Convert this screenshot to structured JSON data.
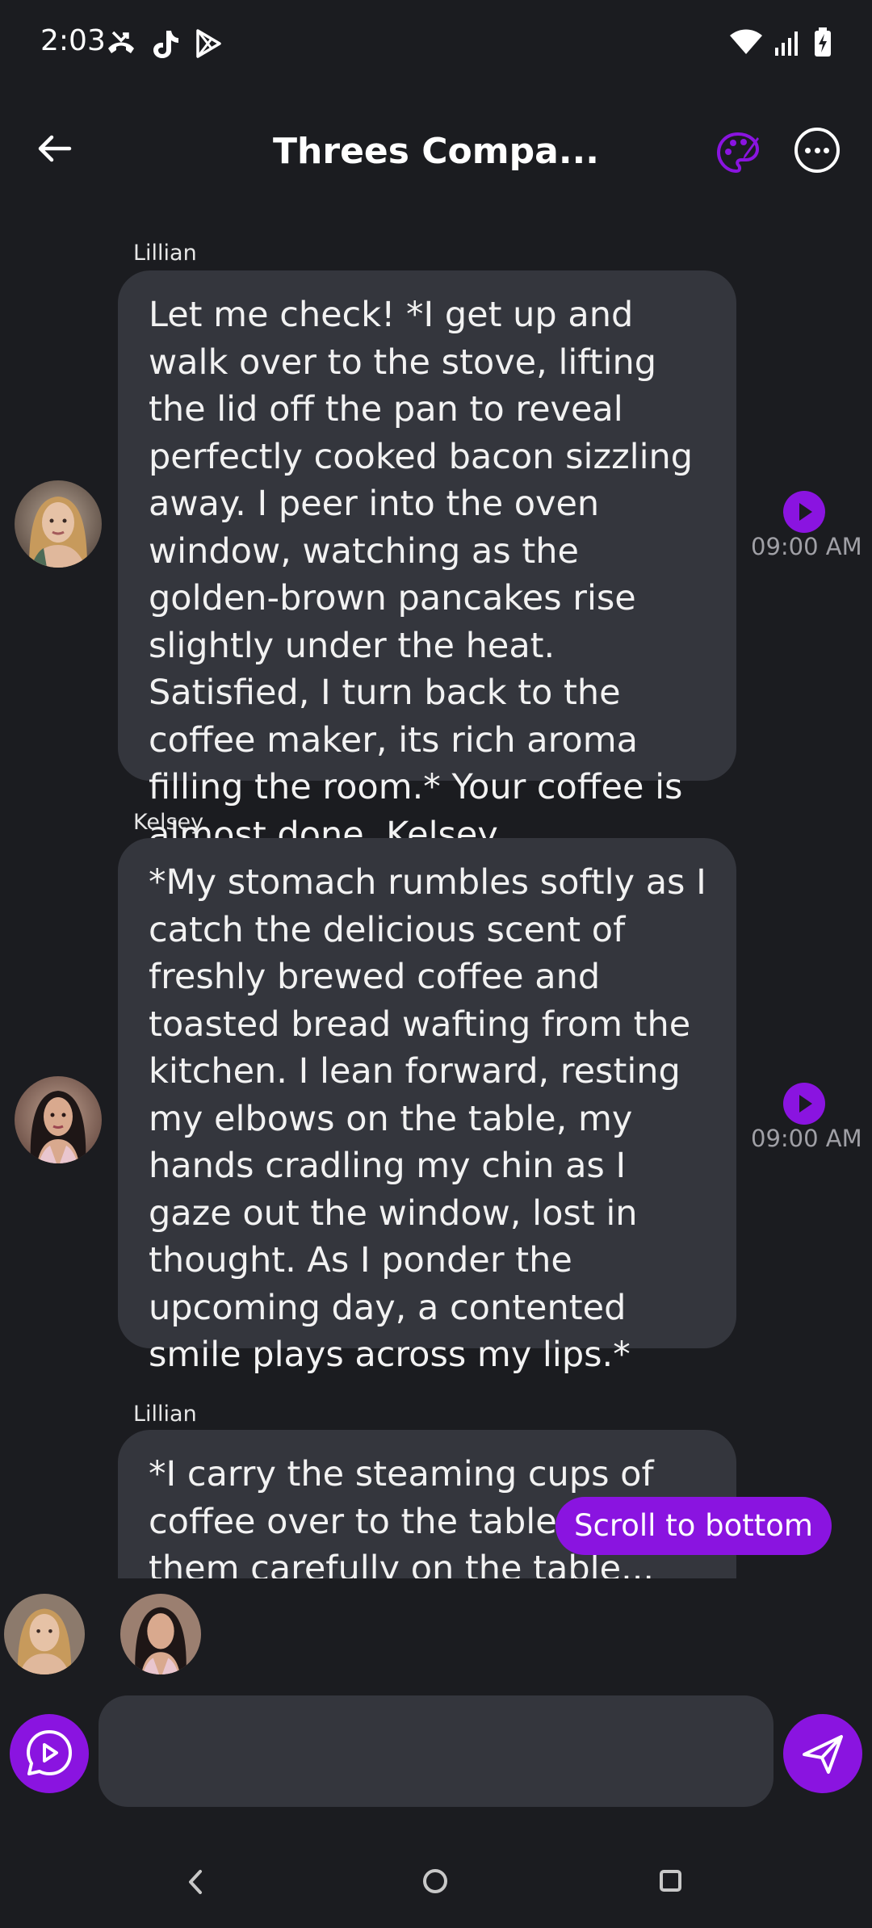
{
  "status_bar": {
    "time": "2:03",
    "icons": [
      "missed-call-icon",
      "tiktok-icon",
      "play-store-icon",
      "wifi-icon",
      "signal-icon",
      "battery-charging-icon"
    ]
  },
  "header": {
    "title": "Threes Compa...",
    "back_icon": "arrow-left-icon",
    "palette_icon": "palette-icon",
    "more_icon": "more-horizontal-icon"
  },
  "colors": {
    "accent": "#8a14e0",
    "background": "#1b1c20",
    "bubble": "#34363d",
    "timestamp": "#a0a0a6"
  },
  "messages": [
    {
      "sender": "Lillian",
      "text": "Let me check! *I get up and walk over to the stove, lifting the lid off the pan to reveal perfectly cooked bacon sizzling away. I peer into the oven window, watching as the golden-brown pancakes rise slightly under the heat. Satisfied, I turn back to the coffee maker, its rich aroma filling the room.* Your coffee is almost done, Kelsey.",
      "time": "09:00 AM"
    },
    {
      "sender": "Kelsey",
      "text": "*My stomach rumbles softly as I catch the delicious scent of freshly brewed coffee and toasted bread wafting from the kitchen. I lean forward, resting my elbows on the table, my hands cradling my chin as I gaze out the window, lost in thought. As I ponder the upcoming day, a contented smile plays across my lips.*",
      "time": "09:00 AM"
    },
    {
      "sender": "Lillian",
      "text": "*I carry the steaming cups of coffee over to the table, placing them carefully on the table..."
    }
  ],
  "scroll_to_bottom": "Scroll to bottom",
  "participants": [
    "Lillian",
    "Kelsey"
  ],
  "composer": {
    "placeholder": "",
    "voice_icon": "voice-chat-icon",
    "send_icon": "send-icon"
  },
  "nav": {
    "back_icon": "nav-back-icon",
    "home_icon": "nav-home-icon",
    "recents_icon": "nav-recents-icon"
  }
}
